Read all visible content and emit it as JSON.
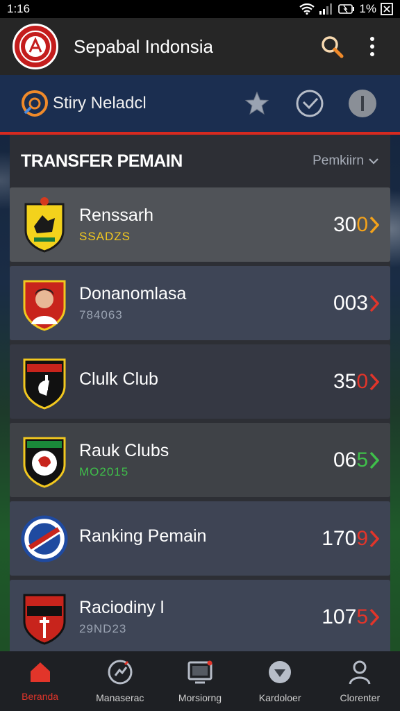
{
  "status": {
    "time": "1:16",
    "battery": "1%"
  },
  "appbar": {
    "title": "Sepabal Indonsia",
    "logo_icon": "club-crest-logo",
    "search_icon": "search-icon",
    "menu_icon": "more-vert-icon"
  },
  "subbar": {
    "title": "Stiry Neladcl",
    "icons": [
      "shield-logo-icon",
      "star-icon",
      "check-circle-icon",
      "info-circle-icon"
    ]
  },
  "section": {
    "title": "TRANSFER PEMAIN",
    "filter_label": "Pemkiirn"
  },
  "colors": {
    "accent_red": "#e2352a",
    "accent_orange": "#f3a21b",
    "accent_green": "#3fbf4a",
    "accent_yellow": "#f2c81f"
  },
  "rows": [
    {
      "name": "Renssarh",
      "sub": "SSADZS",
      "value_main": "30",
      "value_accent": "0",
      "accent_color": "#f3a21b",
      "chev_color": "#f3a21b",
      "sub_color": "#f2c81f",
      "bg": "#505358"
    },
    {
      "name": "Donanomlasa",
      "sub": "784063",
      "value_main": "003",
      "value_accent": "",
      "accent_color": "#ffffff",
      "chev_color": "#e2352a",
      "sub_color": "#9aa3b2",
      "bg": "#3e4556"
    },
    {
      "name": "Clulk Club",
      "sub": "",
      "value_main": "35",
      "value_accent": "0",
      "accent_color": "#e2352a",
      "chev_color": "#e2352a",
      "sub_color": "#9aa3b2",
      "bg": "#353843"
    },
    {
      "name": "Rauk Clubs",
      "sub": "MO2015",
      "value_main": "06",
      "value_accent": "5",
      "accent_color": "#3fbf4a",
      "chev_color": "#3fbf4a",
      "sub_color": "#3fbf4a",
      "bg": "#3f4247"
    },
    {
      "name": "Ranking Pemain",
      "sub": "",
      "value_main": "170",
      "value_accent": "9",
      "accent_color": "#e2352a",
      "chev_color": "#e2352a",
      "sub_color": "#9aa3b2",
      "bg": "#3e4454"
    },
    {
      "name": "Raciodiny l",
      "sub": "29ND23",
      "value_main": "107",
      "value_accent": "5",
      "accent_color": "#e2352a",
      "chev_color": "#e2352a",
      "sub_color": "#9aa3b2",
      "bg": "#3e4556"
    }
  ],
  "nav": [
    {
      "label": "Beranda",
      "icon": "home-icon",
      "active": true
    },
    {
      "label": "Manaserac",
      "icon": "sync-icon",
      "active": false
    },
    {
      "label": "Morsiorng",
      "icon": "monitor-icon",
      "active": false
    },
    {
      "label": "Kardoloer",
      "icon": "shield-check-icon",
      "active": false
    },
    {
      "label": "Clorenter",
      "icon": "person-icon",
      "active": false
    }
  ]
}
